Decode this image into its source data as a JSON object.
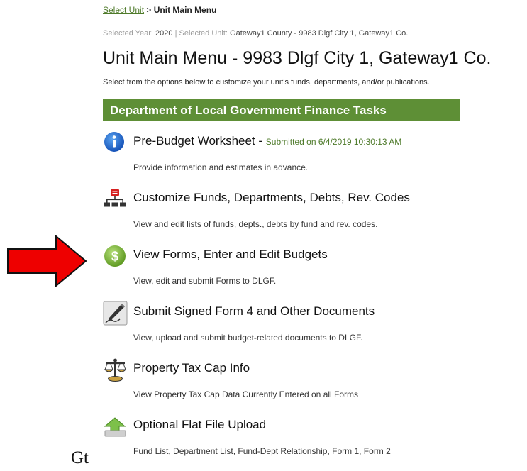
{
  "breadcrumb": {
    "link_label": "Select Unit",
    "separator": ">",
    "current": "Unit Main Menu"
  },
  "selection": {
    "year_label": "Selected Year:",
    "year_value": "2020",
    "divider": "|",
    "unit_label": "Selected Unit:",
    "unit_value": "Gateway1 County - 9983 Dlgf City 1, Gateway1 Co."
  },
  "page": {
    "title": "Unit Main Menu - 9983 Dlgf City 1, Gateway1 Co.",
    "instructions": "Select from the options below to customize your unit's funds, departments, and/or publications."
  },
  "section": {
    "header": "Department of Local Government Finance Tasks"
  },
  "tasks": [
    {
      "title": "Pre-Budget Worksheet",
      "title_suffix": "- ",
      "submitted": "Submitted on 6/4/2019 10:30:13 AM",
      "description": "Provide information and estimates in advance.",
      "icon": "info-icon"
    },
    {
      "title": "Customize Funds, Departments, Debts, Rev. Codes",
      "description": "View and edit lists of funds, depts., debts by fund and rev. codes.",
      "icon": "org-chart-icon"
    },
    {
      "title": "View Forms, Enter and Edit Budgets",
      "description": "View, edit and submit Forms to DLGF.",
      "icon": "dollar-icon"
    },
    {
      "title": "Submit Signed Form 4 and Other Documents",
      "description": "View, upload and submit budget-related documents to DLGF.",
      "icon": "pen-icon"
    },
    {
      "title": "Property Tax Cap Info",
      "description": "View Property Tax Cap Data Currently Entered on all Forms",
      "icon": "scales-icon"
    },
    {
      "title": "Optional Flat File Upload",
      "description": "Fund List, Department List, Fund-Dept Relationship, Form 1, Form 2",
      "icon": "upload-icon"
    }
  ],
  "annotation": {
    "arrow_icon": "red-arrow-icon",
    "arrow_color": "#ee0000",
    "text": "Gt"
  },
  "colors": {
    "accent_green": "#5e8f36",
    "link_green": "#4e7a2a",
    "info_blue": "#1f6fd0",
    "dollar_green": "#8cc043"
  }
}
